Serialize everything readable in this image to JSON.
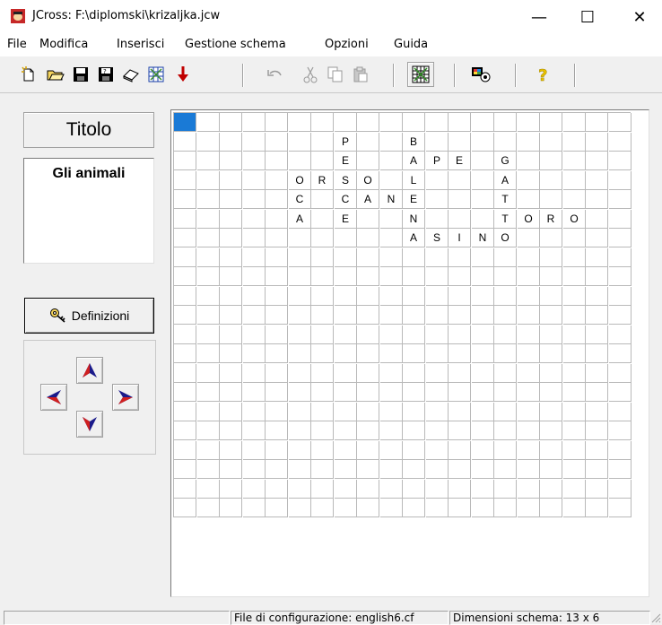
{
  "window": {
    "title": "JCross: F:\\diplomski\\krizaljka.jcw",
    "minimize": "—",
    "maximize": "☐",
    "close": "✕"
  },
  "menu": [
    "File",
    "Modifica",
    "Inserisci",
    "Gestione schema",
    "Opzioni",
    "Guida"
  ],
  "toolbar": {
    "icons": [
      "new-icon",
      "open-icon",
      "save-icon",
      "save-as-icon",
      "erase-icon",
      "generate-icon",
      "down-arrow-icon",
      "undo-icon",
      "cut-icon",
      "copy-icon",
      "paste-icon",
      "grid-icon",
      "colors-icon",
      "help-icon"
    ]
  },
  "left_panel": {
    "titolo_label": "Titolo",
    "title_value": "Gli animali",
    "definizioni_label": "Definizioni"
  },
  "grid": {
    "cols": 20,
    "rows": 21,
    "selected": [
      0,
      0
    ],
    "letters": [
      {
        "r": 1,
        "c": 7,
        "ch": "P"
      },
      {
        "r": 1,
        "c": 10,
        "ch": "B"
      },
      {
        "r": 2,
        "c": 7,
        "ch": "E"
      },
      {
        "r": 2,
        "c": 10,
        "ch": "A"
      },
      {
        "r": 2,
        "c": 11,
        "ch": "P"
      },
      {
        "r": 2,
        "c": 12,
        "ch": "E"
      },
      {
        "r": 2,
        "c": 14,
        "ch": "G"
      },
      {
        "r": 3,
        "c": 5,
        "ch": "O"
      },
      {
        "r": 3,
        "c": 6,
        "ch": "R"
      },
      {
        "r": 3,
        "c": 7,
        "ch": "S"
      },
      {
        "r": 3,
        "c": 8,
        "ch": "O"
      },
      {
        "r": 3,
        "c": 10,
        "ch": "L"
      },
      {
        "r": 3,
        "c": 14,
        "ch": "A"
      },
      {
        "r": 4,
        "c": 5,
        "ch": "C"
      },
      {
        "r": 4,
        "c": 7,
        "ch": "C"
      },
      {
        "r": 4,
        "c": 8,
        "ch": "A"
      },
      {
        "r": 4,
        "c": 9,
        "ch": "N"
      },
      {
        "r": 4,
        "c": 10,
        "ch": "E"
      },
      {
        "r": 4,
        "c": 14,
        "ch": "T"
      },
      {
        "r": 5,
        "c": 5,
        "ch": "A"
      },
      {
        "r": 5,
        "c": 7,
        "ch": "E"
      },
      {
        "r": 5,
        "c": 10,
        "ch": "N"
      },
      {
        "r": 5,
        "c": 14,
        "ch": "T"
      },
      {
        "r": 5,
        "c": 15,
        "ch": "O"
      },
      {
        "r": 5,
        "c": 16,
        "ch": "R"
      },
      {
        "r": 5,
        "c": 17,
        "ch": "O"
      },
      {
        "r": 6,
        "c": 10,
        "ch": "A"
      },
      {
        "r": 6,
        "c": 11,
        "ch": "S"
      },
      {
        "r": 6,
        "c": 12,
        "ch": "I"
      },
      {
        "r": 6,
        "c": 13,
        "ch": "N"
      },
      {
        "r": 6,
        "c": 14,
        "ch": "O"
      }
    ]
  },
  "status": {
    "config": "File di configurazione: english6.cf",
    "dimension": "Dimensioni schema: 13 x 6"
  }
}
